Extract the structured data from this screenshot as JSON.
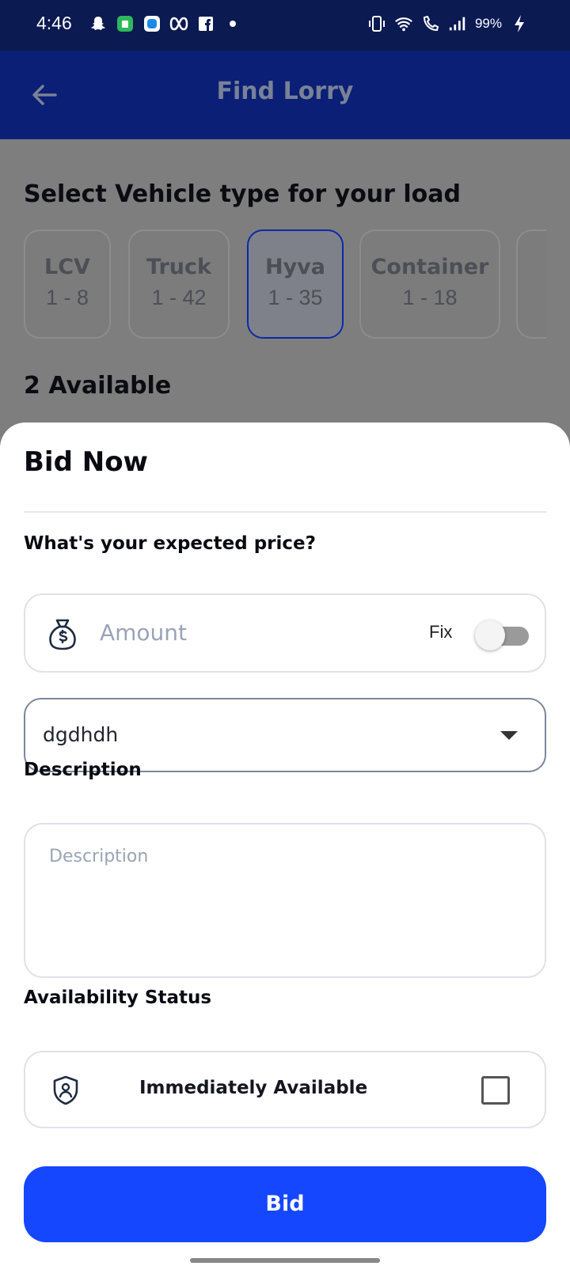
{
  "status_bar": {
    "time": "4:46",
    "left_icons": [
      "snapchat-icon",
      "android-app-icon",
      "blue-app-icon",
      "infinity-app-icon",
      "facebook-icon",
      "notification-dot-icon"
    ],
    "right_icons": [
      "vibrate-icon",
      "wifi-icon",
      "wifi-call-icon",
      "signal-icon",
      "battery-charging-icon"
    ],
    "battery": "99%"
  },
  "app_bar": {
    "title": "Find Lorry",
    "back_icon": "arrow-left-icon"
  },
  "vehicle_section": {
    "title": "Select Vehicle type for your load",
    "vehicles": [
      {
        "name": "LCV",
        "range": "1 - 8",
        "selected": false
      },
      {
        "name": "Truck",
        "range": "1 - 42",
        "selected": false
      },
      {
        "name": "Hyva",
        "range": "1 - 35",
        "selected": true
      },
      {
        "name": "Container",
        "range": "1 - 18",
        "selected": false
      }
    ],
    "available_text": "2 Available"
  },
  "bid_sheet": {
    "title": "Bid Now",
    "price_label": "What's your expected price?",
    "amount_placeholder": "Amount",
    "fix_label": "Fix",
    "fix_enabled": false,
    "select_value": "dgdhdh",
    "description_label": "Description",
    "description_placeholder": "Description",
    "availability_label": "Availability Status",
    "availability_option": "Immediately Available",
    "availability_checked": false,
    "bid_button": "Bid"
  },
  "colors": {
    "status_bar": "#0c1a52",
    "app_bar": "#0a1f75",
    "primary": "#1447ff",
    "selected_border": "#0b2aa8"
  }
}
